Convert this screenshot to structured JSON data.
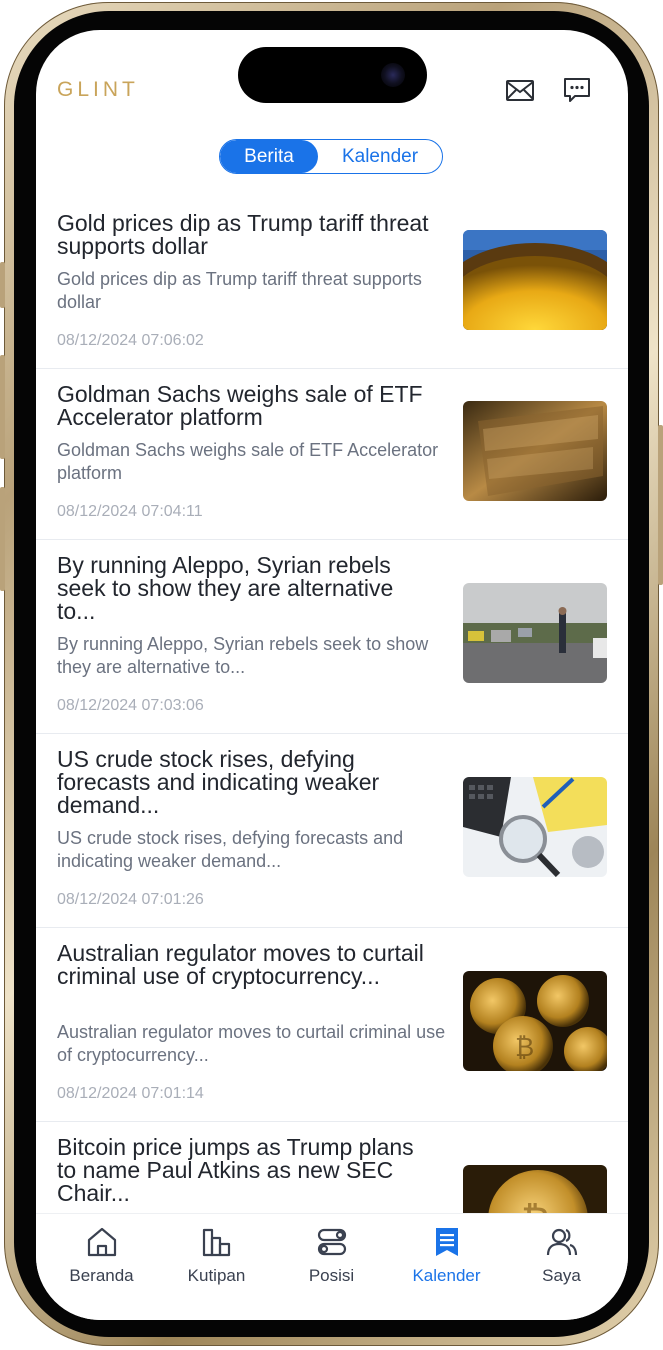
{
  "app": {
    "brand": "GLINT"
  },
  "header": {
    "mail_icon": "mail-icon",
    "chat_icon": "chat-bubble-icon"
  },
  "tabs": {
    "active": "Berita",
    "inactive": "Kalender"
  },
  "news": [
    {
      "title": "Gold prices dip as Trump tariff threat supports dollar",
      "summary": "Gold prices dip as Trump tariff threat supports dollar",
      "time": "08/12/2024 07:06:02",
      "thumb": "gold-nuggets"
    },
    {
      "title": "Goldman Sachs weighs sale of ETF Accelerator platform",
      "summary": "Goldman Sachs weighs sale of ETF Accelerator platform",
      "time": "08/12/2024 07:04:11",
      "thumb": "goldman-sachs-sign"
    },
    {
      "title": "By running Aleppo, Syrian rebels seek to show they are alternative to...",
      "summary": "By running Aleppo, Syrian rebels seek to show they are alternative to...",
      "time": "08/12/2024 07:03:06",
      "thumb": "street-scene"
    },
    {
      "title": "US crude stock rises, defying forecasts and indicating weaker demand...",
      "summary": "US crude stock rises, defying forecasts and indicating weaker demand...",
      "time": "08/12/2024 07:01:26",
      "thumb": "calculator-documents"
    },
    {
      "title": "Australian regulator moves to curtail criminal use of cryptocurrency...",
      "summary": "Australian regulator moves to curtail criminal use of cryptocurrency...",
      "time": "08/12/2024 07:01:14",
      "thumb": "bitcoin-coins"
    },
    {
      "title": "Bitcoin price jumps as Trump plans to name Paul Atkins as new SEC Chair...",
      "thumb": "bitcoin-coin"
    }
  ],
  "bottom_nav": [
    {
      "label": "Beranda",
      "icon": "home-icon"
    },
    {
      "label": "Kutipan",
      "icon": "bar-chart-icon"
    },
    {
      "label": "Posisi",
      "icon": "toggles-icon"
    },
    {
      "label": "Kalender",
      "icon": "bookmark-list-icon",
      "active": true
    },
    {
      "label": "Saya",
      "icon": "users-icon"
    }
  ],
  "colors": {
    "accent": "#1a73e8",
    "brand": "#c9a45a",
    "text": "#22262e",
    "muted": "#6b7280",
    "time": "#a9aeb8"
  }
}
